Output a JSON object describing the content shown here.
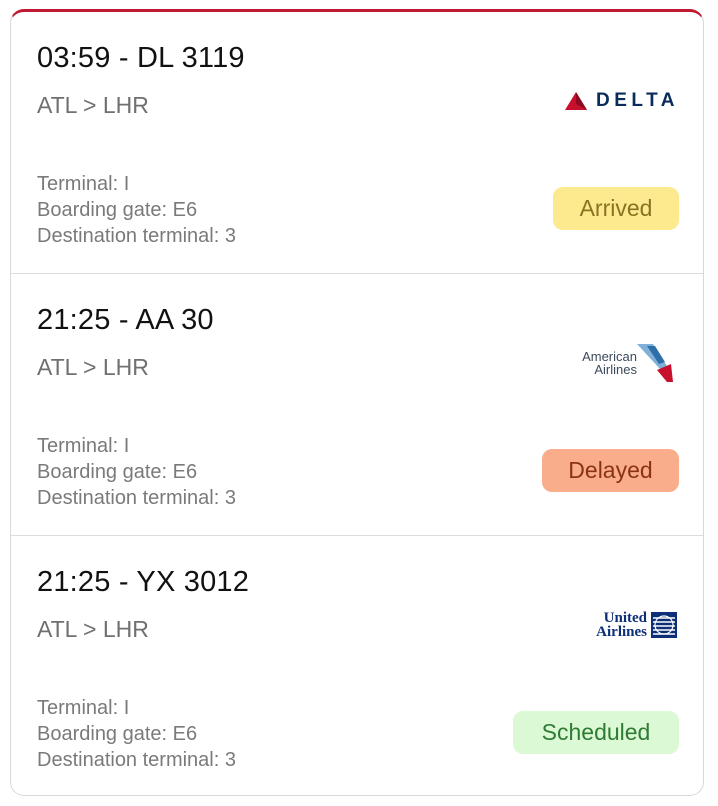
{
  "colors": {
    "accent_top_border": "#c01933",
    "arrived_bg": "#fdea8e",
    "arrived_text": "#8a7322",
    "delayed_bg": "#f9ad8a",
    "delayed_text": "#8c3315",
    "scheduled_bg": "#dcf9d5",
    "scheduled_text": "#2e7b34"
  },
  "flights": [
    {
      "title": "03:59 - DL 3119",
      "route": "ATL > LHR",
      "terminal": "Terminal: I",
      "gate": "Boarding gate: E6",
      "dest_terminal": "Destination terminal: 3",
      "status": "Arrived",
      "airline_logo": {
        "icon": "delta-logo-icon",
        "text": "DELTA"
      }
    },
    {
      "title": "21:25 - AA 30",
      "route": "ATL > LHR",
      "terminal": "Terminal: I",
      "gate": "Boarding gate: E6",
      "dest_terminal": "Destination terminal: 3",
      "status": "Delayed",
      "airline_logo": {
        "icon": "american-airlines-logo-icon",
        "line1": "American",
        "line2": "Airlines"
      }
    },
    {
      "title": "21:25 - YX 3012",
      "route": "ATL > LHR",
      "terminal": "Terminal: I",
      "gate": "Boarding gate: E6",
      "dest_terminal": "Destination terminal: 3",
      "status": "Scheduled",
      "airline_logo": {
        "icon": "united-airlines-logo-icon",
        "line1": "United",
        "line2": "Airlines"
      }
    }
  ]
}
